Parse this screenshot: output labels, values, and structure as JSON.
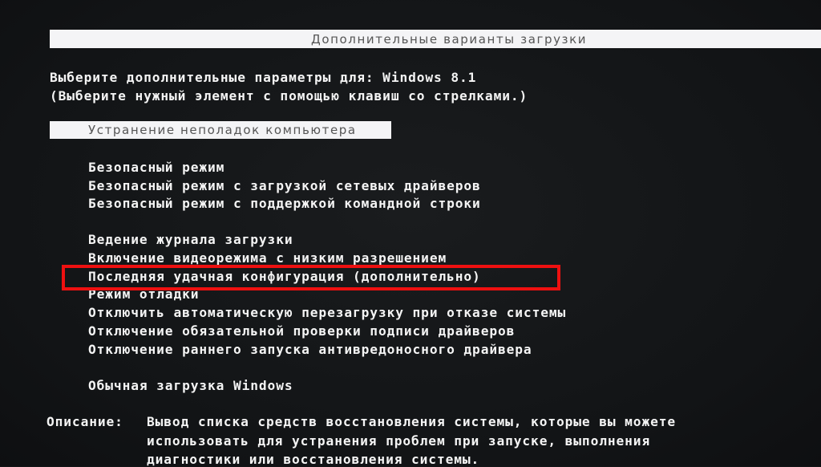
{
  "window": {
    "title": "Дополнительные варианты загрузки"
  },
  "header": {
    "line1": "Выберите дополнительные параметры для: Windows 8.1",
    "line2": "(Выберите нужный элемент с помощью клавиш со стрелками.)"
  },
  "selected_item": {
    "label": "Устранение неполадок компьютера"
  },
  "menu": {
    "group1": [
      {
        "label": "Безопасный режим"
      },
      {
        "label": "Безопасный режим с загрузкой сетевых драйверов"
      },
      {
        "label": "Безопасный режим с поддержкой командной строки"
      }
    ],
    "group2": [
      {
        "label": "Ведение журнала загрузки"
      },
      {
        "label": "Включение видеорежима с низким разрешением"
      },
      {
        "label": "Последняя удачная конфигурация (дополнительно)",
        "annotated": true
      },
      {
        "label": "Режим отладки"
      },
      {
        "label": "Отключить автоматическую перезагрузку при отказе системы"
      },
      {
        "label": "Отключение обязательной проверки подписи драйверов"
      },
      {
        "label": "Отключение раннего запуска антивредоносного драйвера"
      }
    ],
    "group3": [
      {
        "label": "Обычная загрузка Windows"
      }
    ]
  },
  "annotation": {
    "color": "#ee1010"
  },
  "description": {
    "label": "Описание:",
    "lines": [
      "Вывод списка средств восстановления системы, которые вы можете",
      "использовать для устранения проблем при запуске, выполнения",
      "диагностики или восстановления системы."
    ]
  }
}
